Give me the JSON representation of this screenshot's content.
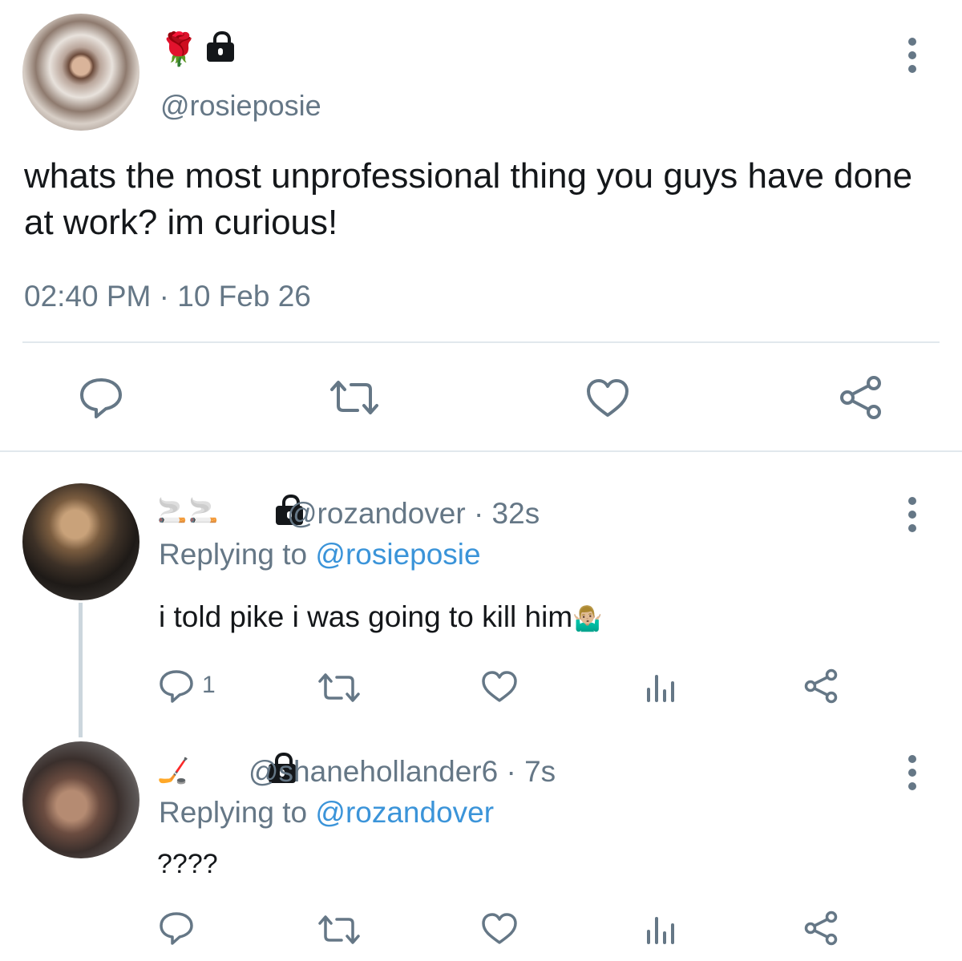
{
  "main_tweet": {
    "handle": "@rosieposie",
    "name_emoji": "🌹",
    "text": "whats the most unprofessional thing you guys have done at work? im curious!",
    "timestamp": "02:40 PM · 10 Feb 26"
  },
  "replies": [
    {
      "name_emoji": "🚬🚬",
      "handle": "@rozandover",
      "time": "· 32s",
      "replying_prefix": "Replying to",
      "replying_to": "@rosieposie",
      "text": "i told pike i was going to kill him",
      "text_emoji": "🤷🏼‍♂️",
      "reply_count": "1"
    },
    {
      "name_emoji": "🏒",
      "handle": "@shanehollander6",
      "time": "· 7s",
      "replying_prefix": "Replying to",
      "replying_to": "@rozandover",
      "text": "????"
    }
  ],
  "colors": {
    "text": "#14171a",
    "secondary": "#657786",
    "link": "#3b94d9",
    "divider": "#e1e8ed"
  }
}
